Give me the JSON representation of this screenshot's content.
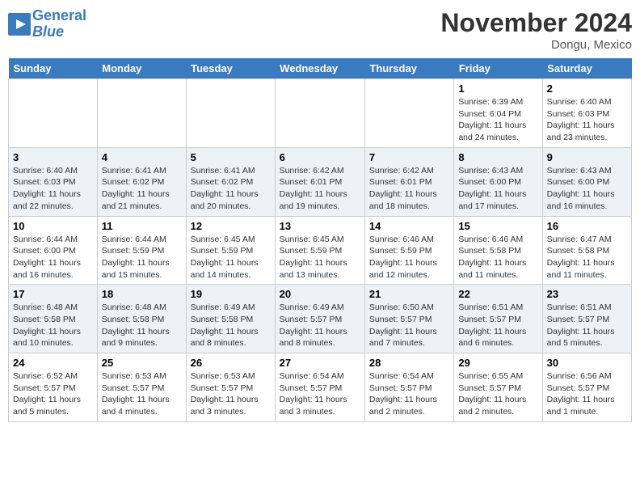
{
  "header": {
    "logo_line1": "General",
    "logo_line2": "Blue",
    "month": "November 2024",
    "location": "Dongu, Mexico"
  },
  "weekdays": [
    "Sunday",
    "Monday",
    "Tuesday",
    "Wednesday",
    "Thursday",
    "Friday",
    "Saturday"
  ],
  "weeks": [
    [
      {
        "day": "",
        "info": ""
      },
      {
        "day": "",
        "info": ""
      },
      {
        "day": "",
        "info": ""
      },
      {
        "day": "",
        "info": ""
      },
      {
        "day": "",
        "info": ""
      },
      {
        "day": "1",
        "info": "Sunrise: 6:39 AM\nSunset: 6:04 PM\nDaylight: 11 hours and 24 minutes."
      },
      {
        "day": "2",
        "info": "Sunrise: 6:40 AM\nSunset: 6:03 PM\nDaylight: 11 hours and 23 minutes."
      }
    ],
    [
      {
        "day": "3",
        "info": "Sunrise: 6:40 AM\nSunset: 6:03 PM\nDaylight: 11 hours and 22 minutes."
      },
      {
        "day": "4",
        "info": "Sunrise: 6:41 AM\nSunset: 6:02 PM\nDaylight: 11 hours and 21 minutes."
      },
      {
        "day": "5",
        "info": "Sunrise: 6:41 AM\nSunset: 6:02 PM\nDaylight: 11 hours and 20 minutes."
      },
      {
        "day": "6",
        "info": "Sunrise: 6:42 AM\nSunset: 6:01 PM\nDaylight: 11 hours and 19 minutes."
      },
      {
        "day": "7",
        "info": "Sunrise: 6:42 AM\nSunset: 6:01 PM\nDaylight: 11 hours and 18 minutes."
      },
      {
        "day": "8",
        "info": "Sunrise: 6:43 AM\nSunset: 6:00 PM\nDaylight: 11 hours and 17 minutes."
      },
      {
        "day": "9",
        "info": "Sunrise: 6:43 AM\nSunset: 6:00 PM\nDaylight: 11 hours and 16 minutes."
      }
    ],
    [
      {
        "day": "10",
        "info": "Sunrise: 6:44 AM\nSunset: 6:00 PM\nDaylight: 11 hours and 16 minutes."
      },
      {
        "day": "11",
        "info": "Sunrise: 6:44 AM\nSunset: 5:59 PM\nDaylight: 11 hours and 15 minutes."
      },
      {
        "day": "12",
        "info": "Sunrise: 6:45 AM\nSunset: 5:59 PM\nDaylight: 11 hours and 14 minutes."
      },
      {
        "day": "13",
        "info": "Sunrise: 6:45 AM\nSunset: 5:59 PM\nDaylight: 11 hours and 13 minutes."
      },
      {
        "day": "14",
        "info": "Sunrise: 6:46 AM\nSunset: 5:59 PM\nDaylight: 11 hours and 12 minutes."
      },
      {
        "day": "15",
        "info": "Sunrise: 6:46 AM\nSunset: 5:58 PM\nDaylight: 11 hours and 11 minutes."
      },
      {
        "day": "16",
        "info": "Sunrise: 6:47 AM\nSunset: 5:58 PM\nDaylight: 11 hours and 11 minutes."
      }
    ],
    [
      {
        "day": "17",
        "info": "Sunrise: 6:48 AM\nSunset: 5:58 PM\nDaylight: 11 hours and 10 minutes."
      },
      {
        "day": "18",
        "info": "Sunrise: 6:48 AM\nSunset: 5:58 PM\nDaylight: 11 hours and 9 minutes."
      },
      {
        "day": "19",
        "info": "Sunrise: 6:49 AM\nSunset: 5:58 PM\nDaylight: 11 hours and 8 minutes."
      },
      {
        "day": "20",
        "info": "Sunrise: 6:49 AM\nSunset: 5:57 PM\nDaylight: 11 hours and 8 minutes."
      },
      {
        "day": "21",
        "info": "Sunrise: 6:50 AM\nSunset: 5:57 PM\nDaylight: 11 hours and 7 minutes."
      },
      {
        "day": "22",
        "info": "Sunrise: 6:51 AM\nSunset: 5:57 PM\nDaylight: 11 hours and 6 minutes."
      },
      {
        "day": "23",
        "info": "Sunrise: 6:51 AM\nSunset: 5:57 PM\nDaylight: 11 hours and 5 minutes."
      }
    ],
    [
      {
        "day": "24",
        "info": "Sunrise: 6:52 AM\nSunset: 5:57 PM\nDaylight: 11 hours and 5 minutes."
      },
      {
        "day": "25",
        "info": "Sunrise: 6:53 AM\nSunset: 5:57 PM\nDaylight: 11 hours and 4 minutes."
      },
      {
        "day": "26",
        "info": "Sunrise: 6:53 AM\nSunset: 5:57 PM\nDaylight: 11 hours and 3 minutes."
      },
      {
        "day": "27",
        "info": "Sunrise: 6:54 AM\nSunset: 5:57 PM\nDaylight: 11 hours and 3 minutes."
      },
      {
        "day": "28",
        "info": "Sunrise: 6:54 AM\nSunset: 5:57 PM\nDaylight: 11 hours and 2 minutes."
      },
      {
        "day": "29",
        "info": "Sunrise: 6:55 AM\nSunset: 5:57 PM\nDaylight: 11 hours and 2 minutes."
      },
      {
        "day": "30",
        "info": "Sunrise: 6:56 AM\nSunset: 5:57 PM\nDaylight: 11 hours and 1 minute."
      }
    ]
  ]
}
